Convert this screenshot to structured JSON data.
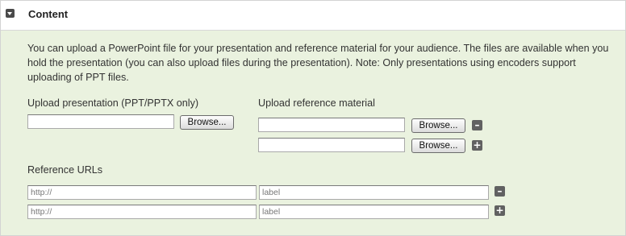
{
  "section": {
    "title": "Content",
    "description": "You can upload a PowerPoint file for your presentation and reference material for your audience. The files are available when you hold the presentation (you can also upload files during the presentation). Note: Only presentations using encoders support uploading of PPT files."
  },
  "upload_presentation": {
    "label": "Upload presentation (PPT/PPTX only)",
    "browse_label": "Browse..."
  },
  "upload_reference": {
    "label": "Upload reference material",
    "rows": [
      {
        "browse_label": "Browse...",
        "action_icon": "minus-icon",
        "action_symbol": "–"
      },
      {
        "browse_label": "Browse...",
        "action_icon": "plus-icon",
        "action_symbol": "+"
      }
    ]
  },
  "reference_urls": {
    "label": "Reference URLs",
    "rows": [
      {
        "url_placeholder": "http://",
        "label_placeholder": "label",
        "action_icon": "minus-icon",
        "action_symbol": "–"
      },
      {
        "url_placeholder": "http://",
        "label_placeholder": "label",
        "action_icon": "plus-icon",
        "action_symbol": "+"
      }
    ]
  },
  "colors": {
    "panel_background": "#eaf2df",
    "header_background": "#ffffff",
    "icon_button": "#616161"
  }
}
